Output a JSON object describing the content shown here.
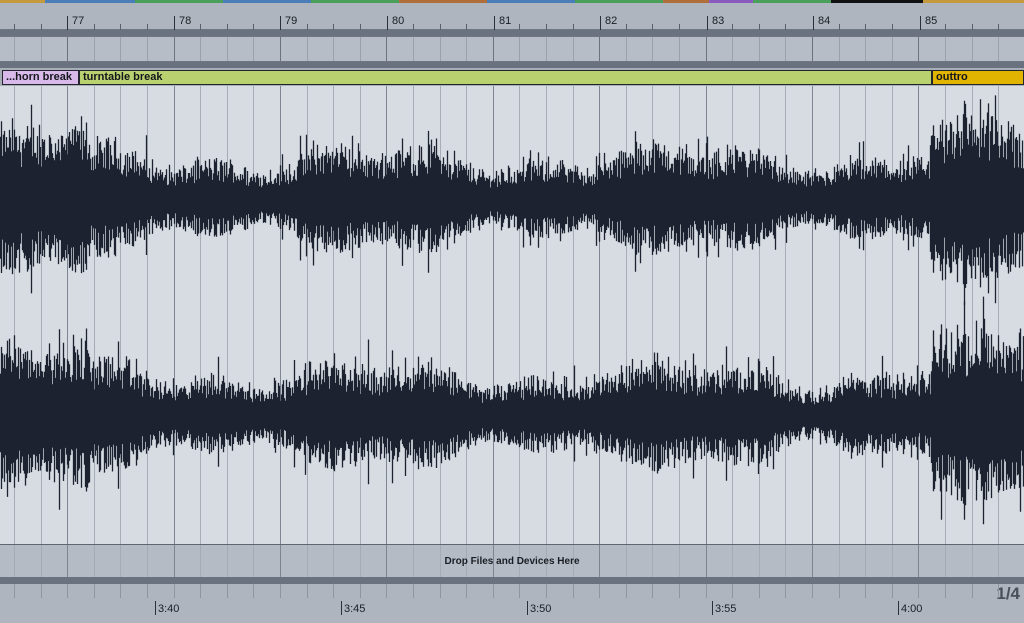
{
  "color_strip": [
    {
      "color": "#c39a3e"
    },
    {
      "color": "#4b7db8"
    },
    {
      "color": "#4aa05a"
    },
    {
      "color": "#4b7db8"
    },
    {
      "color": "#4aa05a"
    },
    {
      "color": "#b06f3a"
    },
    {
      "color": "#4b7db8"
    },
    {
      "color": "#4aa05a"
    },
    {
      "color": "#b06f3a"
    },
    {
      "color": "#8a5bbf"
    },
    {
      "color": "#4aa05a"
    },
    {
      "color": "#111111"
    },
    {
      "color": "#c39a3e"
    }
  ],
  "beat_ruler": {
    "bars": [
      "77",
      "78",
      "79",
      "80",
      "81",
      "82",
      "83",
      "84",
      "85"
    ]
  },
  "locators": [
    {
      "label": "...horn break",
      "color": "#d8b9ea"
    },
    {
      "label": "turntable break",
      "color": "#b9d26f"
    },
    {
      "label": "outtro",
      "color": "#e0b400"
    }
  ],
  "drop_zone": {
    "label": "Drop Files and Devices Here"
  },
  "time_ruler": {
    "labels": [
      "3:40",
      "3:45",
      "3:50",
      "3:55",
      "4:00"
    ]
  },
  "grid": {
    "label": "1/4"
  }
}
